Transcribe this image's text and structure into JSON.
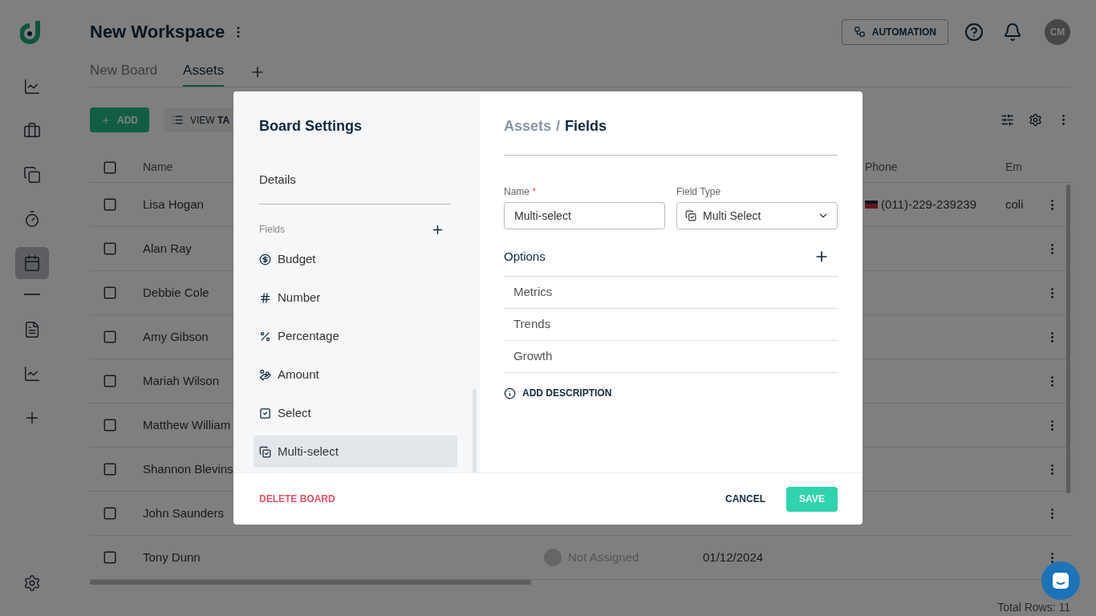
{
  "nav": [
    {
      "kind": "chart",
      "selected": false
    },
    {
      "kind": "briefcase",
      "selected": false
    },
    {
      "kind": "tasks",
      "selected": false
    },
    {
      "kind": "timer",
      "selected": false
    },
    {
      "kind": "calendar",
      "selected": true
    },
    {
      "kind": "document",
      "selected": false
    },
    {
      "kind": "chart",
      "selected": false
    },
    {
      "kind": "add",
      "selected": false
    }
  ],
  "workspace": {
    "title": "New Workspace"
  },
  "tabs": [
    {
      "label": "New Board",
      "selected": false
    },
    {
      "label": "Assets",
      "selected": true
    }
  ],
  "header": {
    "automation": "AUTOMATION",
    "avatar": "CM"
  },
  "toolbar": {
    "add": "ADD",
    "view_table": "VIEW **TA**"
  },
  "table": {
    "all_checked": false,
    "columns": [
      "Name",
      "Phone",
      "Em"
    ],
    "rows": [
      {
        "checked": false,
        "name": "Lisa Hogan",
        "phone": "(011)-229-239239",
        "email": "coli"
      },
      {
        "checked": false,
        "name": "Alan Ray"
      },
      {
        "checked": false,
        "name": "Debbie Cole"
      },
      {
        "checked": false,
        "name": "Amy Gibson"
      },
      {
        "checked": false,
        "name": "Mariah Wilson"
      },
      {
        "checked": false,
        "name": "Matthew William"
      },
      {
        "checked": false,
        "name": "Shannon Blevins"
      },
      {
        "checked": false,
        "name": "John Saunders"
      },
      {
        "checked": false,
        "name": "Tony Dunn",
        "assignee": "Not Assigned",
        "date": "01/12/2024"
      }
    ]
  },
  "total_rows": "Total Rows: 11",
  "modal": {
    "title": "Board Settings",
    "details": "Details",
    "fields_label": "Fields",
    "fields": [
      {
        "label": "Budget",
        "kind": "currency",
        "selected": false
      },
      {
        "label": "Number",
        "kind": "number",
        "selected": false
      },
      {
        "label": "Percentage",
        "kind": "percent",
        "selected": false
      },
      {
        "label": "Amount",
        "kind": "amount",
        "selected": false
      },
      {
        "label": "Select",
        "kind": "select",
        "selected": false
      },
      {
        "label": "Multi-select",
        "kind": "multiselect",
        "selected": true
      }
    ],
    "breadcrumb": [
      "Assets",
      "/",
      "Fields"
    ],
    "name_label": "Name",
    "required": "*",
    "name_value": "Multi-select",
    "type_label": "Field Type",
    "type_value": "Multi Select",
    "options_label": "Options",
    "options": [
      "Metrics",
      "Trends",
      "Growth"
    ],
    "add_description": "ADD DESCRIPTION",
    "delete": "DELETE BOARD",
    "cancel": "CANCEL",
    "save": "SAVE"
  }
}
